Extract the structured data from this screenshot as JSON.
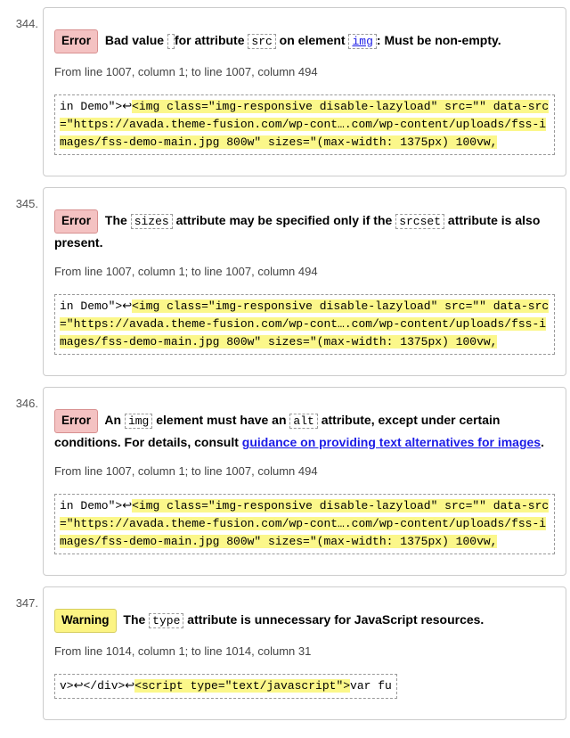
{
  "messages": [
    {
      "num": "344.",
      "badge_type": "error",
      "badge_label": "Error",
      "headline_parts": [
        {
          "t": "text",
          "v": "Bad value "
        },
        {
          "t": "code",
          "v": ""
        },
        {
          "t": "text",
          "v": " for attribute "
        },
        {
          "t": "code",
          "v": "src"
        },
        {
          "t": "text",
          "v": " on element "
        },
        {
          "t": "code-link",
          "v": "img"
        },
        {
          "t": "text",
          "v": ": Must be non-empty."
        }
      ],
      "location": "From line 1007, column 1; to line 1007, column 494",
      "extract_plain": "in Demo\">↩",
      "extract_hl": "<img class=\"img-responsive disable-lazyload\" src=\"\" data-src=\"https://avada.theme-fusion.com/wp-cont….com/wp-content/uploads/fss-images/fss-demo-main.jpg 800w\" sizes=\"(max-width: 1375px) 100vw,"
    },
    {
      "num": "345.",
      "badge_type": "error",
      "badge_label": "Error",
      "headline_parts": [
        {
          "t": "text",
          "v": "The "
        },
        {
          "t": "code",
          "v": "sizes"
        },
        {
          "t": "text",
          "v": " attribute may be specified only if the "
        },
        {
          "t": "code",
          "v": "srcset"
        },
        {
          "t": "text",
          "v": " attribute is also present."
        }
      ],
      "location": "From line 1007, column 1; to line 1007, column 494",
      "extract_plain": "in Demo\">↩",
      "extract_hl": "<img class=\"img-responsive disable-lazyload\" src=\"\" data-src=\"https://avada.theme-fusion.com/wp-cont….com/wp-content/uploads/fss-images/fss-demo-main.jpg 800w\" sizes=\"(max-width: 1375px) 100vw,"
    },
    {
      "num": "346.",
      "badge_type": "error",
      "badge_label": "Error",
      "headline_parts": [
        {
          "t": "text",
          "v": "An "
        },
        {
          "t": "code",
          "v": "img"
        },
        {
          "t": "text",
          "v": " element must have an "
        },
        {
          "t": "code",
          "v": "alt"
        },
        {
          "t": "text",
          "v": " attribute, except under certain conditions. For details, consult "
        },
        {
          "t": "link",
          "v": "guidance on providing text alternatives for images"
        },
        {
          "t": "text",
          "v": "."
        }
      ],
      "location": "From line 1007, column 1; to line 1007, column 494",
      "extract_plain": "in Demo\">↩",
      "extract_hl": "<img class=\"img-responsive disable-lazyload\" src=\"\" data-src=\"https://avada.theme-fusion.com/wp-cont….com/wp-content/uploads/fss-images/fss-demo-main.jpg 800w\" sizes=\"(max-width: 1375px) 100vw,"
    },
    {
      "num": "347.",
      "badge_type": "warning",
      "badge_label": "Warning",
      "headline_parts": [
        {
          "t": "text",
          "v": "The "
        },
        {
          "t": "code",
          "v": "type"
        },
        {
          "t": "text",
          "v": " attribute is unnecessary for JavaScript resources."
        }
      ],
      "location": "From line 1014, column 1; to line 1014, column 31",
      "extract_plain": "v>↩</div>↩",
      "extract_hl": "<script type=\"text/javascript\">",
      "extract_trail": "var fu"
    }
  ]
}
